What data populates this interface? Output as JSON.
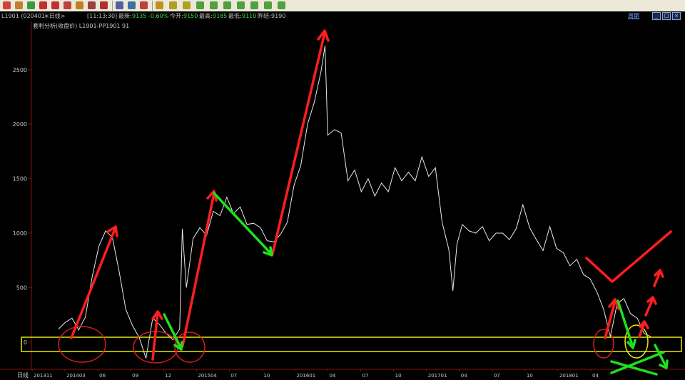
{
  "toolbar": {
    "icons": [
      "home-icon",
      "open-icon",
      "refresh-icon",
      "zoom-in-icon",
      "zoom-out-icon",
      "draw-icon",
      "pen-icon",
      "eraser-icon",
      "filter-icon",
      "table-icon",
      "list-icon",
      "kline-icon",
      "f10-icon",
      "period-1-icon",
      "period-5-icon",
      "period-15-icon",
      "period-30-icon",
      "period-60-icon",
      "day-icon",
      "week-icon",
      "month-icon",
      "year-icon"
    ]
  },
  "infobar": {
    "contract": "L1901 (020401)",
    "view": "<日线>",
    "time": "[11:13:30]",
    "last_label": "最新:",
    "last": "9135",
    "change": "-0.60%",
    "open_label": "今开:",
    "open": "9150",
    "high_label": "最高:",
    "high": "9185",
    "low_label": "最低:",
    "low": "9110",
    "prevclose_label": "昨结:",
    "prevclose": "9190",
    "cycle_link": "周期"
  },
  "chart_data": {
    "type": "line",
    "title": "套利分析(收盘价)  L1901-PP1901  91",
    "period_label": "日线",
    "ylim": [
      -250,
      2950
    ],
    "yticks": [
      0,
      500,
      1000,
      1500,
      2000,
      2500
    ],
    "xticks": [
      "201311",
      "201403",
      "06",
      "09",
      "12",
      "201504",
      "07",
      "10",
      "201601",
      "04",
      "07",
      "10",
      "2017|01",
      "04",
      "07",
      "10",
      "201801",
      "04"
    ],
    "series": [
      {
        "values": [
          [
            0,
            120
          ],
          [
            5,
            180
          ],
          [
            10,
            220
          ],
          [
            15,
            110
          ],
          [
            20,
            230
          ],
          [
            25,
            600
          ],
          [
            30,
            880
          ],
          [
            35,
            1020
          ],
          [
            40,
            960
          ],
          [
            45,
            650
          ],
          [
            50,
            300
          ],
          [
            55,
            150
          ],
          [
            60,
            40
          ],
          [
            65,
            -150
          ],
          [
            70,
            220
          ],
          [
            75,
            160
          ],
          [
            80,
            80
          ],
          [
            85,
            20
          ],
          [
            90,
            120
          ],
          [
            92,
            1040
          ],
          [
            95,
            500
          ],
          [
            100,
            950
          ],
          [
            105,
            1050
          ],
          [
            110,
            980
          ],
          [
            115,
            1200
          ],
          [
            120,
            1160
          ],
          [
            125,
            1330
          ],
          [
            130,
            1180
          ],
          [
            135,
            1240
          ],
          [
            140,
            1080
          ],
          [
            145,
            1090
          ],
          [
            150,
            1050
          ],
          [
            155,
            930
          ],
          [
            160,
            920
          ],
          [
            165,
            990
          ],
          [
            170,
            1100
          ],
          [
            175,
            1440
          ],
          [
            180,
            1620
          ],
          [
            185,
            2000
          ],
          [
            190,
            2200
          ],
          [
            195,
            2480
          ],
          [
            198,
            2720
          ],
          [
            200,
            1900
          ],
          [
            205,
            1950
          ],
          [
            210,
            1920
          ],
          [
            215,
            1480
          ],
          [
            220,
            1580
          ],
          [
            225,
            1380
          ],
          [
            230,
            1500
          ],
          [
            235,
            1340
          ],
          [
            240,
            1460
          ],
          [
            245,
            1380
          ],
          [
            250,
            1600
          ],
          [
            255,
            1480
          ],
          [
            260,
            1560
          ],
          [
            265,
            1480
          ],
          [
            270,
            1700
          ],
          [
            275,
            1520
          ],
          [
            280,
            1600
          ],
          [
            285,
            1100
          ],
          [
            290,
            850
          ],
          [
            293,
            470
          ],
          [
            296,
            900
          ],
          [
            300,
            1080
          ],
          [
            305,
            1020
          ],
          [
            310,
            1000
          ],
          [
            315,
            1060
          ],
          [
            320,
            930
          ],
          [
            325,
            1000
          ],
          [
            330,
            1000
          ],
          [
            335,
            940
          ],
          [
            340,
            1040
          ],
          [
            345,
            1260
          ],
          [
            350,
            1050
          ],
          [
            355,
            940
          ],
          [
            360,
            840
          ],
          [
            365,
            1060
          ],
          [
            370,
            860
          ],
          [
            375,
            820
          ],
          [
            380,
            700
          ],
          [
            385,
            760
          ],
          [
            390,
            620
          ],
          [
            395,
            580
          ],
          [
            400,
            460
          ],
          [
            405,
            300
          ],
          [
            410,
            50
          ],
          [
            415,
            350
          ],
          [
            420,
            400
          ],
          [
            425,
            260
          ],
          [
            430,
            220
          ],
          [
            435,
            80
          ],
          [
            440,
            50
          ]
        ]
      }
    ]
  },
  "annotations": {
    "red_arrows": 7,
    "green_arrows": 5,
    "red_circles": 4,
    "yellow_circle": 1,
    "yellow_band": "0"
  }
}
